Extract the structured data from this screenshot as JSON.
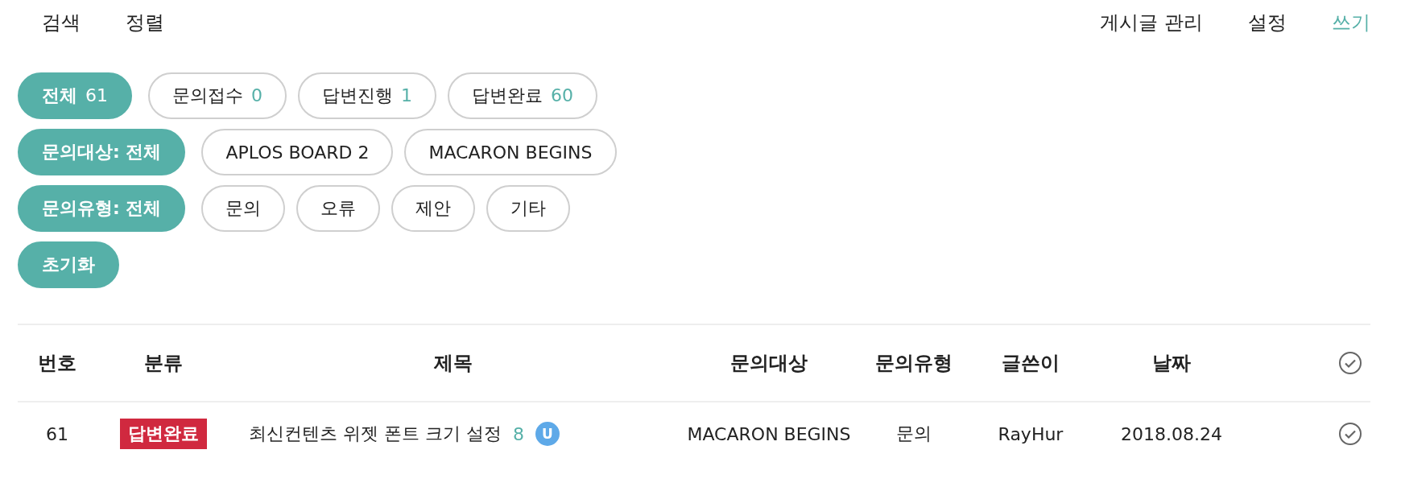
{
  "nav": {
    "left": [
      {
        "label": "검색",
        "highlighted": false
      },
      {
        "label": "정렬",
        "highlighted": false
      }
    ],
    "right": [
      {
        "label": "게시글 관리",
        "highlighted": false
      },
      {
        "label": "설정",
        "highlighted": false
      },
      {
        "label": "쓰기",
        "highlighted": true
      }
    ]
  },
  "filters": [
    {
      "chips": [
        {
          "label": "전체",
          "count": "61",
          "selected": true
        },
        {
          "label": "문의접수",
          "count": "0",
          "selected": false
        },
        {
          "label": "답변진행",
          "count": "1",
          "selected": false
        },
        {
          "label": "답변완료",
          "count": "60",
          "selected": false
        }
      ]
    },
    {
      "chips": [
        {
          "label": "문의대상: 전체",
          "selected": true
        },
        {
          "label": "APLOS BOARD 2",
          "selected": false
        },
        {
          "label": "MACARON BEGINS",
          "selected": false
        }
      ]
    },
    {
      "chips": [
        {
          "label": "문의유형: 전체",
          "selected": true
        },
        {
          "label": "문의",
          "selected": false
        },
        {
          "label": "오류",
          "selected": false
        },
        {
          "label": "제안",
          "selected": false
        },
        {
          "label": "기타",
          "selected": false
        }
      ]
    },
    {
      "chips": [
        {
          "label": "초기화",
          "selected": true
        }
      ]
    }
  ],
  "table": {
    "columns": [
      "번호",
      "분류",
      "제목",
      "문의대상",
      "문의유형",
      "글쓴이",
      "날짜"
    ],
    "rows": [
      {
        "number": "61",
        "status": "답변완료",
        "title": "최신컨텐츠 위젯 폰트 크기 설정",
        "comments": "8",
        "user_badge": "U",
        "target": "MACARON BEGINS",
        "type": "문의",
        "author": "RayHur",
        "date": "2018.08.24"
      }
    ]
  }
}
